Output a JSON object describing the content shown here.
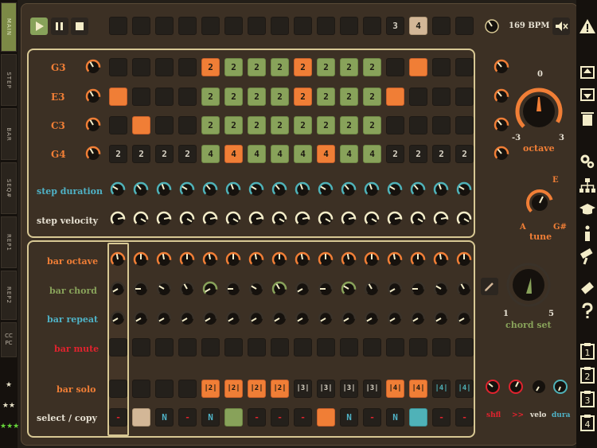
{
  "left_tabs": [
    {
      "label": "MAIN",
      "active": true
    },
    {
      "label": "STEP",
      "active": false
    },
    {
      "label": "BAR",
      "active": false
    },
    {
      "label": "SEQ#",
      "active": false
    },
    {
      "label": "REP1",
      "active": false
    },
    {
      "label": "REP2",
      "active": false
    },
    {
      "label": "CC\nPC",
      "active": false
    }
  ],
  "star_buttons": [
    "★",
    "★★",
    "★★★"
  ],
  "transport": {
    "tempo": "169 BPM",
    "bar_selected": "4",
    "bar_other": "3"
  },
  "notes": [
    "G3",
    "E3",
    "C3",
    "G4"
  ],
  "step_rows": [
    [
      "off",
      "off",
      "off",
      "off",
      "o2",
      "g2",
      "g2",
      "g2",
      "o2",
      "g2",
      "g2",
      "g2",
      "off",
      "o",
      "off",
      "off"
    ],
    [
      "o",
      "off",
      "off",
      "off",
      "g2",
      "g2",
      "g2",
      "g2",
      "o2",
      "g2",
      "g2",
      "g2",
      "o",
      "off",
      "off",
      "off"
    ],
    [
      "off",
      "o",
      "off",
      "off",
      "g2",
      "g2",
      "g2",
      "g2",
      "g2",
      "g2",
      "g2",
      "g2",
      "off",
      "off",
      "off",
      "off"
    ],
    [
      "d2",
      "d2",
      "d2",
      "d2",
      "g4",
      "o4",
      "g4",
      "g4",
      "g4",
      "o4",
      "g4",
      "g4",
      "d2",
      "d2",
      "d2",
      "d2"
    ]
  ],
  "row_labels": {
    "step_duration": "step duration",
    "step_velocity": "step velocity",
    "bar_octave": "bar octave",
    "bar_chord": "bar chord",
    "bar_repeat": "bar repeat",
    "bar_mute": "bar mute",
    "bar_solo": "bar solo",
    "select_copy": "select / copy"
  },
  "bar_solo": [
    "",
    "",
    "",
    "",
    "|2|",
    "|2|",
    "|2|",
    "|2|",
    "|3|",
    "|3|",
    "|3|",
    "|3|",
    "|4|",
    "|4|",
    "|4|",
    "|4|"
  ],
  "bar_solo_style": [
    "d",
    "d",
    "d",
    "d",
    "o",
    "o",
    "o",
    "o",
    "d",
    "d",
    "d",
    "d",
    "o",
    "o",
    "d",
    "d"
  ],
  "select_copy": [
    "-",
    "tan",
    "N",
    "-",
    "N",
    "green",
    "-",
    "-",
    "-",
    "orange",
    "N",
    "-",
    "N",
    "teal",
    "-",
    "-"
  ],
  "octave": {
    "label": "octave",
    "min": "-3",
    "max": "3",
    "center": "0"
  },
  "tune": {
    "label": "tune",
    "low": "A",
    "high": "G#",
    "top": "E"
  },
  "chord_set": {
    "label": "chord set",
    "min": "1",
    "max": "5"
  },
  "bottom_controls": [
    "shfl",
    ">>",
    "velo",
    "dura"
  ],
  "colors": {
    "orange": "#f07e36",
    "green": "#88a25a",
    "teal": "#4fb2b8",
    "tan": "#d3b797",
    "red": "#e0232e",
    "cream": "#f3ecc8"
  }
}
